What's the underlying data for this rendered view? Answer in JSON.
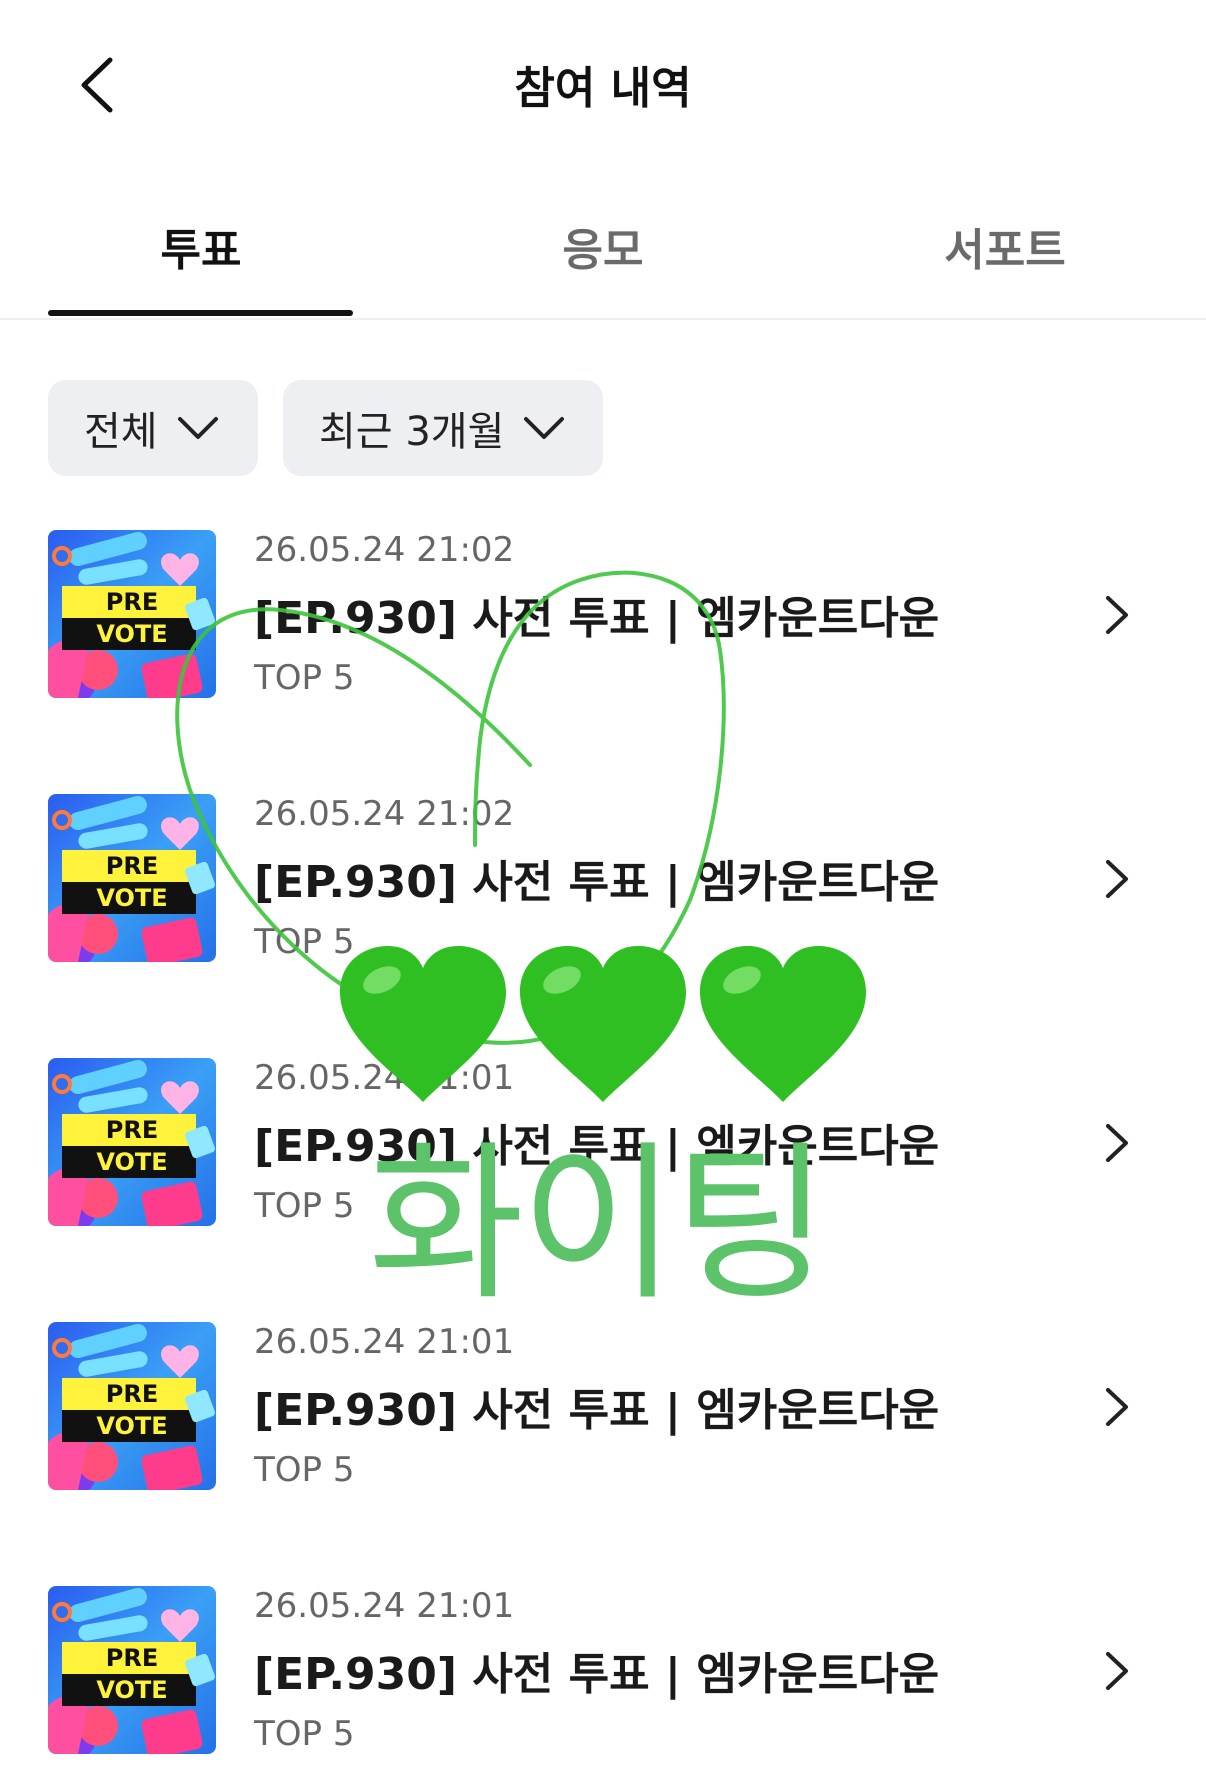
{
  "header": {
    "title": "참여 내역"
  },
  "tabs": [
    {
      "label": "투표",
      "active": true
    },
    {
      "label": "응모",
      "active": false
    },
    {
      "label": "서포트",
      "active": false
    }
  ],
  "filters": {
    "type": "전체",
    "period": "최근 3개월"
  },
  "items": [
    {
      "date": "26.05.24 21:02",
      "title": "[EP.930] 사전 투표 | 엠카운트다운",
      "sub": "TOP 5",
      "thumb": {
        "line1": "PRE",
        "line2": "VOTE"
      }
    },
    {
      "date": "26.05.24 21:02",
      "title": "[EP.930] 사전 투표 | 엠카운트다운",
      "sub": "TOP 5",
      "thumb": {
        "line1": "PRE",
        "line2": "VOTE"
      }
    },
    {
      "date": "26.05.24 21:01",
      "title": "[EP.930] 사전 투표 | 엠카운트다운",
      "sub": "TOP 5",
      "thumb": {
        "line1": "PRE",
        "line2": "VOTE"
      }
    },
    {
      "date": "26.05.24 21:01",
      "title": "[EP.930] 사전 투표 | 엠카운트다운",
      "sub": "TOP 5",
      "thumb": {
        "line1": "PRE",
        "line2": "VOTE"
      }
    },
    {
      "date": "26.05.24 21:01",
      "title": "[EP.930] 사전 투표 | 엠카운트다운",
      "sub": "TOP 5",
      "thumb": {
        "line1": "PRE",
        "line2": "VOTE"
      }
    }
  ],
  "decoration": {
    "text": "화이팅",
    "color": "#5cc36a",
    "hearts": [
      "green-heart-emoji",
      "green-heart-emoji",
      "green-heart-emoji"
    ],
    "heart_color": "#2fbf23",
    "doodle": "green-drawn-heart"
  }
}
